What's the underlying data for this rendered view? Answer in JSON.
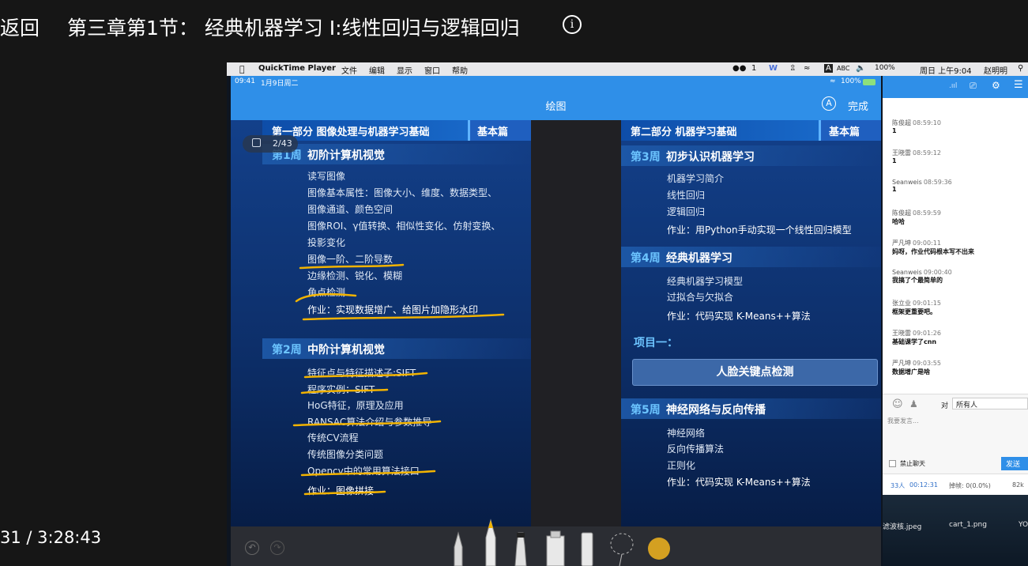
{
  "player": {
    "back_label": "返回",
    "lesson_title": "第三章第1节： 经典机器学习 I:线性回归与逻辑回归",
    "time_readout": "31 / 3:28:43"
  },
  "mac_menubar": {
    "app": "QuickTime Player",
    "menus": [
      "文件",
      "编辑",
      "显示",
      "窗口",
      "帮助"
    ],
    "status_right": {
      "wechat_count": "1",
      "abc": "ABC",
      "battery": "100%",
      "datetime": "周日 上午9:04",
      "user": "赵明明"
    }
  },
  "ipad": {
    "status_time": "09:41",
    "status_date": "1月9日周二",
    "battery": "100%",
    "nav_title": "绘图",
    "done_label": "完成",
    "page_indicator": "2/43"
  },
  "slide_left": {
    "part_title": "第一部分 图像处理与机器学习基础",
    "part_tag": "基本篇",
    "week1": {
      "num": "第1周",
      "title": "初阶计算机视觉",
      "items": [
        "读写图像",
        "图像基本属性：图像大小、维度、数据类型、",
        "图像通道、颜色空间",
        "图像ROI、γ值转换、相似性变化、仿射变换、",
        "投影变化",
        "图像一阶、二阶导数",
        "边缘检测、锐化、模糊",
        "角点检测"
      ],
      "homework": "作业：实现数据增广、给图片加隐形水印"
    },
    "week2": {
      "num": "第2周",
      "title": "中阶计算机视觉",
      "items": [
        "特征点与特征描述子:SIFT",
        "程序实例：SIFT",
        "HoG特征，原理及应用",
        "RANSAC算法介绍与参数推导",
        "传统CV流程",
        "传统图像分类问题",
        "Opencv中的常用算法接口"
      ],
      "homework": "作业：图像拼接"
    }
  },
  "slide_right": {
    "part_title": "第二部分 机器学习基础",
    "part_tag": "基本篇",
    "week3": {
      "num": "第3周",
      "title": "初步认识机器学习",
      "items": [
        "机器学习简介",
        "线性回归",
        "逻辑回归"
      ],
      "homework": "作业：用Python手动实现一个线性回归模型"
    },
    "week4": {
      "num": "第4周",
      "title": "经典机器学习",
      "items": [
        "经典机器学习模型",
        "过拟合与欠拟合"
      ],
      "homework": "作业：代码实现 K-Means++算法"
    },
    "project_label": "项目一：",
    "project_button": "人脸关键点检测",
    "week5": {
      "num": "第5周",
      "title": "神经网络与反向传播",
      "items": [
        "神经网络",
        "反向传播算法",
        "正则化"
      ],
      "homework": "作业：代码实现 K-Means++算法"
    }
  },
  "chat": {
    "messages": [
      {
        "name": "陈俊超",
        "time": "08:59:10",
        "text": "1"
      },
      {
        "name": "王晓雷",
        "time": "08:59:12",
        "text": "1"
      },
      {
        "name": "Seanweis",
        "time": "08:59:36",
        "text": "1"
      },
      {
        "name": "陈俊超",
        "time": "08:59:59",
        "text": "哈哈"
      },
      {
        "name": "严凡坤",
        "time": "09:00:11",
        "text": "妈呀，作业代码根本写不出来"
      },
      {
        "name": "Seanweis",
        "time": "09:00:40",
        "text": "我搞了个最简单的"
      },
      {
        "name": "张立业",
        "time": "09:01:15",
        "text": "框架更重要吧。"
      },
      {
        "name": "王晓雷",
        "time": "09:01:26",
        "text": "基础课学了cnn"
      },
      {
        "name": "严凡坤",
        "time": "09:03:55",
        "text": "数据增广是啥"
      }
    ],
    "to_label": "对",
    "recipient": "所有人",
    "input_placeholder": "我要发言...",
    "mute_label": "禁止聊天",
    "send_label": "发送",
    "stats": {
      "people": "33人",
      "duration": "00:12:31",
      "loss": "掉帧: 0(0.0%)",
      "rate": "82k"
    }
  },
  "desktop_files": [
    "滤波核.jpeg",
    "cart_1.png",
    "YO"
  ],
  "colors": {
    "accent": "#2f8fe8",
    "underline": "#f2b300",
    "slide": "#0d2f6a"
  }
}
